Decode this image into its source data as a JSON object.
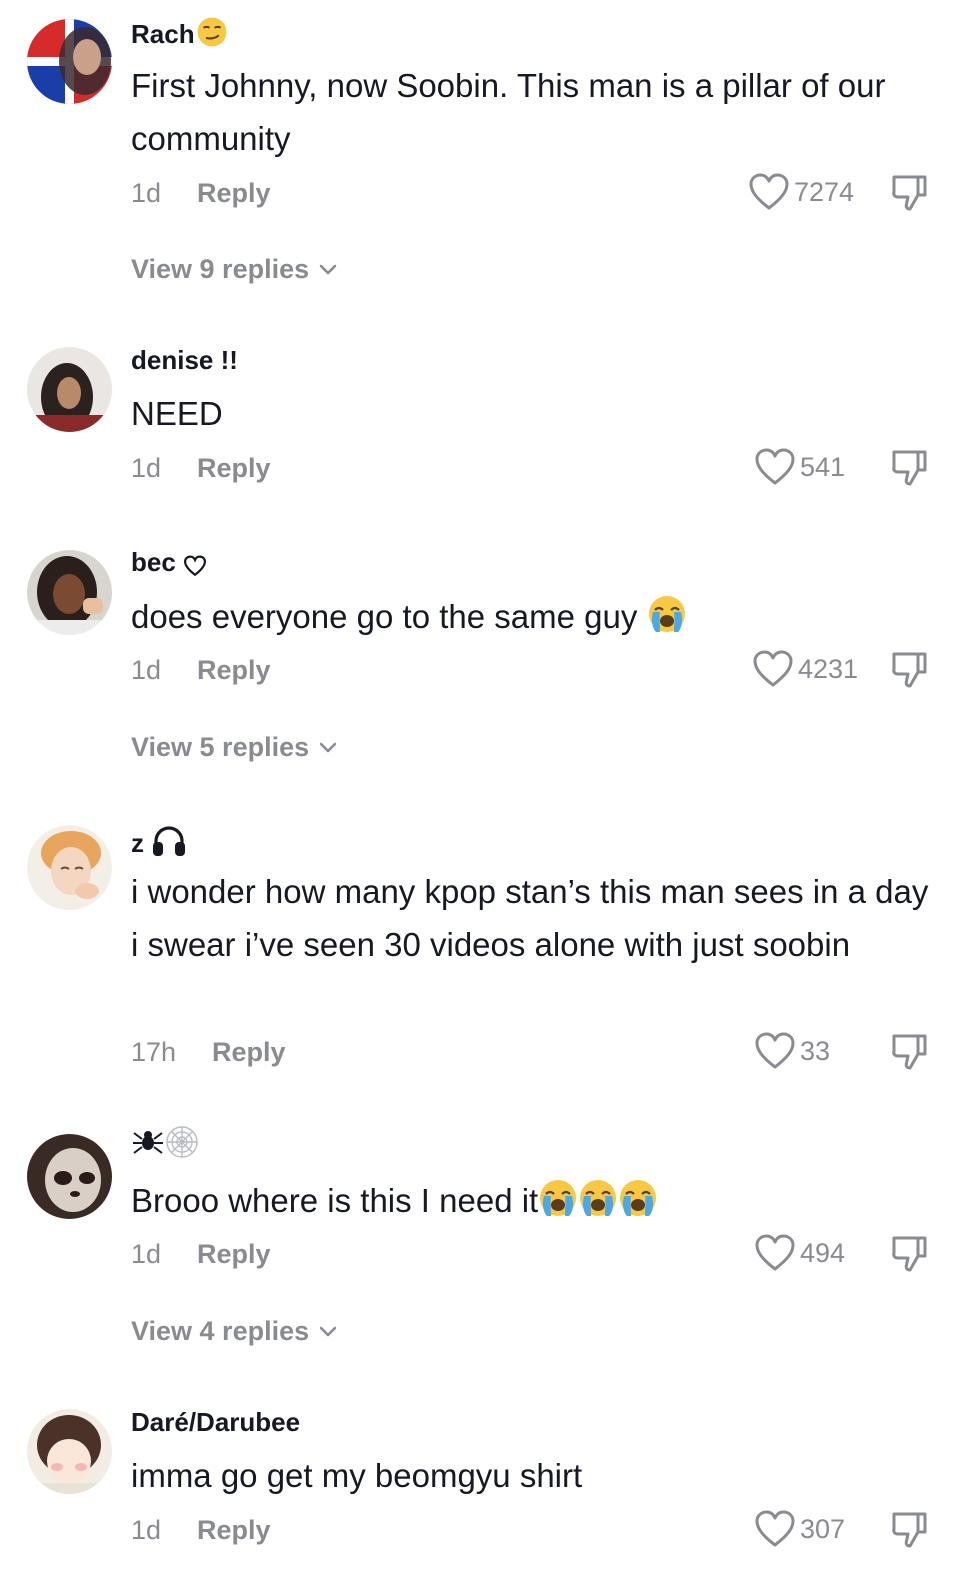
{
  "comments": [
    {
      "username": "Rach",
      "username_emoji": "smirk-emoji",
      "text": "First Johnny, now Soobin. This man is a pillar of our community",
      "time": "1d",
      "reply_label": "Reply",
      "likes": "7274",
      "view_replies": "View 9 replies"
    },
    {
      "username": "denise !!",
      "text": "NEED",
      "time": "1d",
      "reply_label": "Reply",
      "likes": "541"
    },
    {
      "username": "bec",
      "username_emoji": "heart-outline-emoji",
      "text": "does everyone go to the same guy",
      "text_emoji": "loudly-crying-emoji",
      "time": "1d",
      "reply_label": "Reply",
      "likes": "4231",
      "view_replies": "View 5 replies"
    },
    {
      "username": "z",
      "username_emoji": "headphones-emoji",
      "text": "i wonder how many kpop stan’s this man sees in a day i swear i’ve seen 30 videos alone with just soobin",
      "time": "17h",
      "reply_label": "Reply",
      "likes": "33"
    },
    {
      "username_emoji": "spider-and-web-emoji",
      "text": "Brooo where is this I need it",
      "text_emoji": "loudly-crying-emoji-x3",
      "time": "1d",
      "reply_label": "Reply",
      "likes": "494",
      "view_replies": "View 4 replies"
    },
    {
      "username": "Daré/Darubee",
      "text": "imma go get my beomgyu shirt",
      "time": "1d",
      "reply_label": "Reply",
      "likes": "307"
    }
  ],
  "colors": {
    "text_primary": "#161823",
    "text_secondary": "#8a8b91",
    "background": "#ffffff"
  }
}
